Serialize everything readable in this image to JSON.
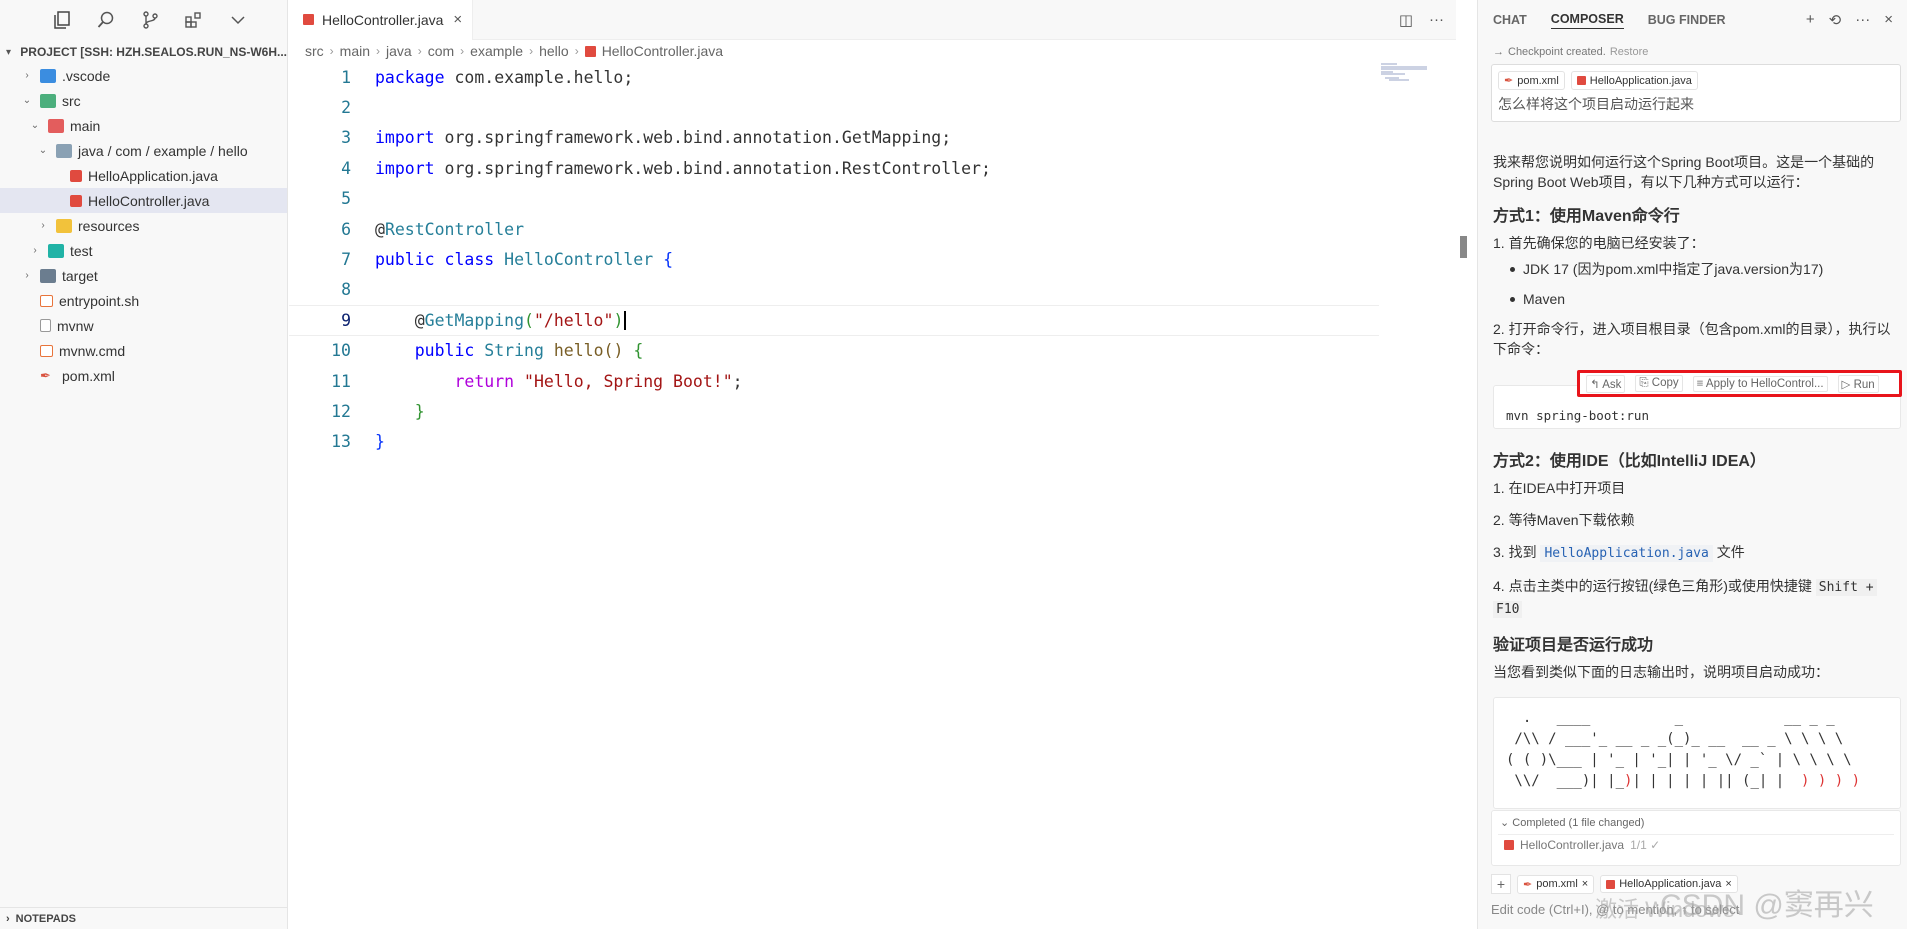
{
  "sidebar": {
    "project_title": "PROJECT [SSH: HZH.SEALOS.RUN_NS-W6H...",
    "tree": [
      {
        "label": ".vscode",
        "icon": "vscode-folder-icon"
      },
      {
        "label": "src",
        "icon": "src-folder-icon"
      },
      {
        "label": "main",
        "icon": "main-folder-icon"
      },
      {
        "label": "java / com / example / hello",
        "icon": "folder-icon"
      },
      {
        "label": "HelloApplication.java",
        "icon": "java-file-icon"
      },
      {
        "label": "HelloController.java",
        "icon": "java-file-icon"
      },
      {
        "label": "resources",
        "icon": "resources-folder-icon"
      },
      {
        "label": "test",
        "icon": "test-folder-icon"
      },
      {
        "label": "target",
        "icon": "target-folder-icon"
      },
      {
        "label": "entrypoint.sh",
        "icon": "shell-file-icon"
      },
      {
        "label": "mvnw",
        "icon": "file-icon"
      },
      {
        "label": "mvnw.cmd",
        "icon": "shell-file-icon"
      },
      {
        "label": "pom.xml",
        "icon": "maven-file-icon"
      }
    ],
    "notepads": "NOTEPADS"
  },
  "editor": {
    "tab": "HelloController.java",
    "breadcrumb": [
      "src",
      "main",
      "java",
      "com",
      "example",
      "hello",
      "HelloController.java"
    ],
    "line_numbers": [
      "1",
      "2",
      "3",
      "4",
      "5",
      "6",
      "7",
      "8",
      "9",
      "10",
      "11",
      "12",
      "13"
    ]
  },
  "panel": {
    "tabs": [
      "CHAT",
      "COMPOSER",
      "BUG FINDER"
    ],
    "checkpoint": "Checkpoint created.",
    "restore": "Restore",
    "chips": [
      "pom.xml",
      "HelloApplication.java"
    ],
    "question": "怎么样将这个项目启动运行起来",
    "intro": "我来帮您说明如何运行这个Spring Boot项目。这是一个基础的Spring Boot Web项目，有以下几种方式可以运行：",
    "h1": "方式1：使用Maven命令行",
    "step1": "1. 首先确保您的电脑已经安装了：",
    "bullet1": "JDK 17 (因为pom.xml中指定了java.version为17)",
    "bullet2": "Maven",
    "step2": "2. 打开命令行，进入项目根目录（包含pom.xml的目录），执行以下命令：",
    "command": "mvn spring-boot:run",
    "cmd_actions": [
      "Ask",
      "Copy",
      "Apply to HelloControl...",
      "Run"
    ],
    "h2": "方式2：使用IDE（比如IntelliJ IDEA）",
    "m2_1": "1. 在IDEA中打开项目",
    "m2_2": "2. 等待Maven下载依赖",
    "m2_3a": "3. 找到",
    "m2_3code": "HelloApplication.java",
    "m2_3b": "文件",
    "m2_4a": "4. 点击主类中的运行按钮(绿色三角形)或使用快捷键",
    "m2_4k1": "Shift +",
    "m2_4k2": "F10",
    "h3": "验证项目是否运行成功",
    "verify": "当您看到类似下面的日志输出时，说明项目启动成功：",
    "completed": "Completed (1 file changed)",
    "changed_file": "HelloController.java",
    "changed_count": "1/1 ✓",
    "bottom_chips": [
      "pom.xml",
      "HelloApplication.java"
    ],
    "edit_placeholder": "Edit code (Ctrl+I), @ to mention, ↑ to select",
    "watermark_os": "激活 Windows",
    "watermark_csdn": "CSDN @窦再兴"
  }
}
